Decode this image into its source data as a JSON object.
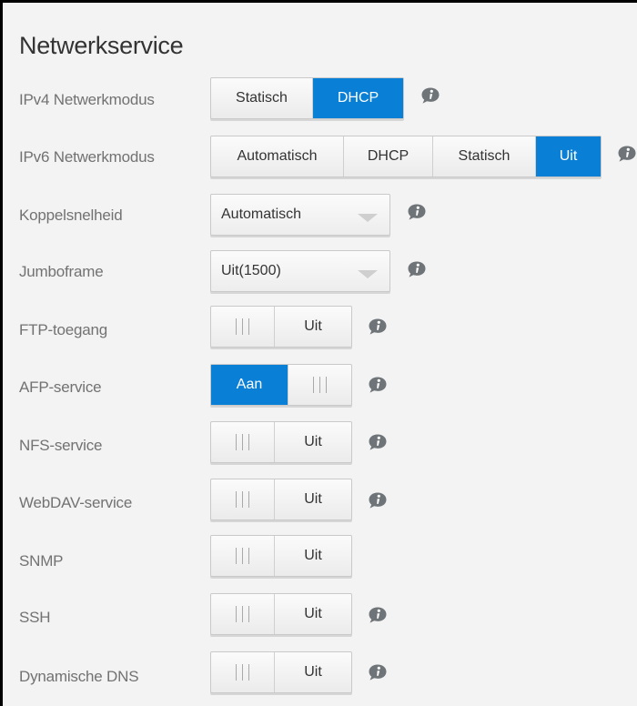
{
  "page": {
    "title": "Netwerkservice"
  },
  "rows": {
    "ipv4": {
      "label": "IPv4 Netwerkmodus",
      "options": [
        "Statisch",
        "DHCP"
      ],
      "selected": "DHCP"
    },
    "ipv6": {
      "label": "IPv6 Netwerkmodus",
      "options": [
        "Automatisch",
        "DHCP",
        "Statisch",
        "Uit"
      ],
      "selected": "Uit"
    },
    "link_speed": {
      "label": "Koppelsnelheid",
      "value": "Automatisch"
    },
    "jumbo_frame": {
      "label": "Jumboframe",
      "value": "Uit(1500)"
    },
    "ftp": {
      "label": "FTP-toegang",
      "state": "Uit",
      "on": false
    },
    "afp": {
      "label": "AFP-service",
      "state": "Aan",
      "on": true
    },
    "nfs": {
      "label": "NFS-service",
      "state": "Uit",
      "on": false
    },
    "webdav": {
      "label": "WebDAV-service",
      "state": "Uit",
      "on": false
    },
    "snmp": {
      "label": "SNMP",
      "state": "Uit",
      "on": false
    },
    "ssh": {
      "label": "SSH",
      "state": "Uit",
      "on": false
    },
    "ddns": {
      "label": "Dynamische DNS",
      "state": "Uit",
      "on": false
    }
  },
  "colors": {
    "accent": "#0a7fd6",
    "info_icon": "#6f7478"
  },
  "icons": {
    "info": "info-icon"
  }
}
